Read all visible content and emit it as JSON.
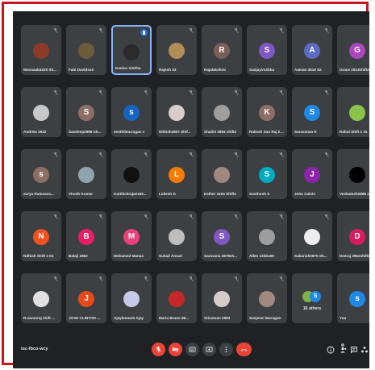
{
  "meeting": {
    "code": "tsc-fbco-wcy"
  },
  "colors": {
    "background": "#202124",
    "tile": "#3c4043",
    "active_border": "#8ab4f8",
    "danger": "#ea4335",
    "speaking": "#1a73e8"
  },
  "participants": [
    {
      "name": "Moosaab3220 Sh...",
      "initial": "",
      "color": "#8d3b26",
      "photo": true
    },
    {
      "name": "Fabi Davidson",
      "initial": "",
      "color": "#6e5b3a",
      "photo": true
    },
    {
      "name": "Eunice Vinitha",
      "initial": "",
      "color": "#2a2a2a",
      "photo": true
    },
    {
      "name": "Rajesh 03",
      "initial": "",
      "color": "#b08d57",
      "photo": true
    },
    {
      "name": "Rajalakshmi",
      "initial": "R",
      "color": "#7b5e57"
    },
    {
      "name": "SanjayVs2bba",
      "initial": "S",
      "color": "#7e57c2"
    },
    {
      "name": "Aaman 3518 S2",
      "initial": "A",
      "color": "#5c6bc0"
    },
    {
      "name": "Grace 2913shift2",
      "initial": "G",
      "color": "#ab47bc"
    },
    {
      "name": "Andrew 2922",
      "initial": "",
      "color": "#c8c8c8",
      "photo": true
    },
    {
      "name": "Sandeep2998 Sh...",
      "initial": "S",
      "color": "#8d6e63"
    },
    {
      "name": "senthilmurugan v",
      "initial": "s",
      "color": "#1565c0"
    },
    {
      "name": "Nithish2867 Shif...",
      "initial": "",
      "color": "#d7ccc8",
      "photo": true
    },
    {
      "name": "Shalini 2894 shift2",
      "initial": "",
      "color": "#9e9e9e",
      "photo": true
    },
    {
      "name": "Rakesh San Raj 28...",
      "initial": "K",
      "color": "#8d6e63"
    },
    {
      "name": "Saravanan K",
      "initial": "S",
      "color": "#1e88e5"
    },
    {
      "name": "Rahul Shift 2 31",
      "initial": "",
      "color": "#8bc34a",
      "photo": true
    },
    {
      "name": "surya Ramnava...",
      "initial": "s",
      "color": "#8d6e63"
    },
    {
      "name": "Vinoth Kumar",
      "initial": "",
      "color": "#90a4ae",
      "photo": true
    },
    {
      "name": "Karthickraja2169...",
      "initial": "",
      "color": "#111111",
      "photo": true
    },
    {
      "name": "Lokesh G",
      "initial": "L",
      "color": "#f57c00"
    },
    {
      "name": "Esther 3194 Shift2",
      "initial": "",
      "color": "#a1887f",
      "photo": true
    },
    {
      "name": "Santhosh S",
      "initial": "S",
      "color": "#00acc1"
    },
    {
      "name": "John Calvin",
      "initial": "J",
      "color": "#8e24aa"
    },
    {
      "name": "Venkatesh2868 a...",
      "initial": "",
      "color": "#000000",
      "photo": true
    },
    {
      "name": "Nithish Shift 2 04",
      "initial": "N",
      "color": "#f4511e"
    },
    {
      "name": "Balaji 2852",
      "initial": "B",
      "color": "#e91e63"
    },
    {
      "name": "Mohamed Manas",
      "initial": "M",
      "color": "#ec407a"
    },
    {
      "name": "Suhail Ansari",
      "initial": "",
      "color": "#bdbdbd",
      "photo": true
    },
    {
      "name": "Saravana 2878sh...",
      "initial": "S",
      "color": "#7e57c2"
    },
    {
      "name": "Allen s2bba09",
      "initial": "",
      "color": "#9e9e9e",
      "photo": true
    },
    {
      "name": "Sabarish2875 Sh...",
      "initial": "",
      "color": "#eeeeee",
      "photo": true
    },
    {
      "name": "Deeraj 2952shift2",
      "initial": "D",
      "color": "#d81b60"
    },
    {
      "name": "R.varunraj shift ...",
      "initial": "",
      "color": "#e0e0e0",
      "photo": true
    },
    {
      "name": "JOXE CLINTON ...",
      "initial": "J",
      "color": "#e64a19"
    },
    {
      "name": "Ajaykumarb Ajay",
      "initial": "",
      "color": "#c5cae9",
      "photo": true
    },
    {
      "name": "Maria Bruno 88...",
      "initial": "",
      "color": "#c62828",
      "photo": true
    },
    {
      "name": "Srivatsan 2883",
      "initial": "",
      "color": "#d7ccc8",
      "photo": true
    },
    {
      "name": "Sanjeevi Murugan",
      "initial": "",
      "color": "#a1887f",
      "photo": true
    },
    {
      "name": "16 others",
      "initial": "",
      "others": true
    },
    {
      "name": "You",
      "initial": "s",
      "color": "#1e88e5"
    }
  ],
  "controls": [
    "mic-off",
    "camera-off",
    "captions",
    "present",
    "more",
    "leave"
  ],
  "side_icons": [
    "info",
    "people",
    "chat",
    "activities"
  ]
}
